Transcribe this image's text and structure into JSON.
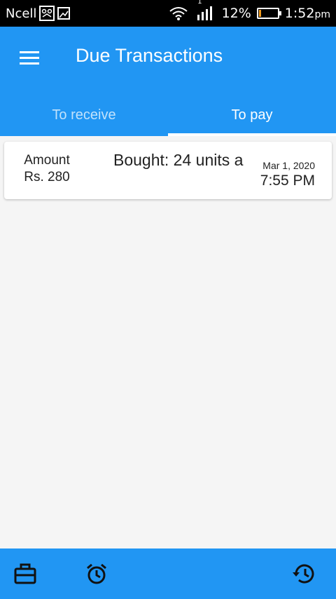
{
  "status_bar": {
    "carrier": "Ncell",
    "signal_label": "1",
    "battery_percent_text": "12%",
    "battery_level": 0.12,
    "time": "1:52",
    "ampm": "pm"
  },
  "app_bar": {
    "title": "Due Transactions",
    "menu_icon": "menu-icon"
  },
  "tabs": [
    {
      "label": "To receive",
      "active": false
    },
    {
      "label": "To pay",
      "active": true
    }
  ],
  "transactions": [
    {
      "amount_label": "Amount",
      "amount_value": "Rs. 280",
      "description": "Bought: 24 units a",
      "date": "Mar 1, 2020",
      "time": "7:55 PM"
    }
  ],
  "bottom_nav": {
    "icons": [
      "briefcase-icon",
      "alarm-icon",
      "history-icon"
    ]
  },
  "colors": {
    "primary": "#2196f3",
    "background": "#f5f5f5",
    "battery_low": "#f29b1d"
  }
}
